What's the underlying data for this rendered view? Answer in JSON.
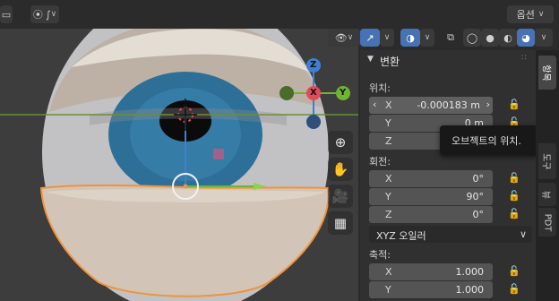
{
  "header": {
    "options_label": "옵션",
    "options_chevron": "∨"
  },
  "panel": {
    "section_title": "변환",
    "location_label": "위치:",
    "location": [
      {
        "axis": "X",
        "value": "-0.000183 m"
      },
      {
        "axis": "Y",
        "value": "0 m"
      },
      {
        "axis": "Z",
        "value": ""
      }
    ],
    "rotation_label": "회전:",
    "rotation": [
      {
        "axis": "X",
        "value": "0°"
      },
      {
        "axis": "Y",
        "value": "90°"
      },
      {
        "axis": "Z",
        "value": "0°"
      }
    ],
    "rotation_mode": "XYZ 오일러",
    "scale_label": "축적:",
    "scale": [
      {
        "axis": "X",
        "value": "1.000"
      },
      {
        "axis": "Y",
        "value": "1.000"
      }
    ]
  },
  "tooltip": {
    "text": "오브젝트의 위치."
  },
  "gizmo": {
    "x": "X",
    "y": "Y",
    "z": "Z"
  },
  "tabs": {
    "item": "항목",
    "tool": "도구",
    "view": "뷰",
    "pdt": "PDT"
  },
  "colors": {
    "accent": "#4772b3",
    "axis_x": "#e24a5c",
    "axis_y": "#6fb52e",
    "axis_z": "#3f7fd1",
    "selection": "#f0933a"
  },
  "icons": [
    "cursor-icon",
    "curve-icon",
    "view-icon",
    "gizmo-icon",
    "overlay-icon",
    "xray-icon",
    "shading-solid-icon",
    "shading-wire-icon",
    "shading-material-icon",
    "shading-rendered-icon",
    "zoom-icon",
    "hand-icon",
    "camera-icon",
    "grid-icon",
    "lock-icon"
  ]
}
